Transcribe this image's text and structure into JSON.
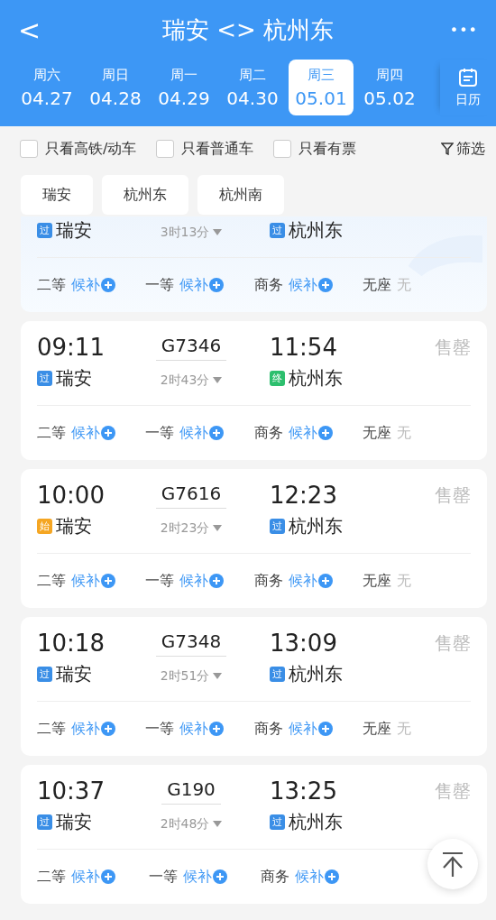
{
  "header": {
    "back": "<",
    "title": "瑞安 <> 杭州东",
    "more": "•••"
  },
  "dates": [
    {
      "weekday": "周六",
      "date": "04.27",
      "selected": false
    },
    {
      "weekday": "周日",
      "date": "04.28",
      "selected": false
    },
    {
      "weekday": "周一",
      "date": "04.29",
      "selected": false
    },
    {
      "weekday": "周二",
      "date": "04.30",
      "selected": false
    },
    {
      "weekday": "周三",
      "date": "05.01",
      "selected": true
    },
    {
      "weekday": "周四",
      "date": "05.02",
      "selected": false
    }
  ],
  "calendar": {
    "label": "日历"
  },
  "filters": [
    {
      "label": "只看高铁/动车",
      "checked": false
    },
    {
      "label": "只看普通车",
      "checked": false
    },
    {
      "label": "只看有票",
      "checked": false
    }
  ],
  "filter_button": "筛选",
  "stations": [
    "瑞安",
    "杭州东",
    "杭州南"
  ],
  "trains": [
    {
      "kind": "partial",
      "from": {
        "badge": "过",
        "color": "#3a8ee6",
        "name": "瑞安"
      },
      "duration": "3时13分",
      "to": {
        "badge": "过",
        "color": "#3a8ee6",
        "name": "杭州东"
      },
      "seats": [
        {
          "class": "二等",
          "status": "候补",
          "kind": "waitlist"
        },
        {
          "class": "一等",
          "status": "候补",
          "kind": "waitlist"
        },
        {
          "class": "商务",
          "status": "候补",
          "kind": "waitlist"
        },
        {
          "class": "无座",
          "status": "无",
          "kind": "none"
        }
      ]
    },
    {
      "kind": "full",
      "depart": "09:11",
      "number": "G7346",
      "arrive": "11:54",
      "status": "售罄",
      "from": {
        "badge": "过",
        "color": "#3a8ee6",
        "name": "瑞安"
      },
      "duration": "2时43分",
      "to": {
        "badge": "终",
        "color": "#2dbf6e",
        "name": "杭州东"
      },
      "seats": [
        {
          "class": "二等",
          "status": "候补",
          "kind": "waitlist"
        },
        {
          "class": "一等",
          "status": "候补",
          "kind": "waitlist"
        },
        {
          "class": "商务",
          "status": "候补",
          "kind": "waitlist"
        },
        {
          "class": "无座",
          "status": "无",
          "kind": "none"
        }
      ]
    },
    {
      "kind": "full",
      "depart": "10:00",
      "number": "G7616",
      "arrive": "12:23",
      "status": "售罄",
      "from": {
        "badge": "始",
        "color": "#f5a623",
        "name": "瑞安"
      },
      "duration": "2时23分",
      "to": {
        "badge": "过",
        "color": "#3a8ee6",
        "name": "杭州东"
      },
      "seats": [
        {
          "class": "二等",
          "status": "候补",
          "kind": "waitlist"
        },
        {
          "class": "一等",
          "status": "候补",
          "kind": "waitlist"
        },
        {
          "class": "商务",
          "status": "候补",
          "kind": "waitlist"
        },
        {
          "class": "无座",
          "status": "无",
          "kind": "none"
        }
      ]
    },
    {
      "kind": "full",
      "depart": "10:18",
      "number": "G7348",
      "arrive": "13:09",
      "status": "售罄",
      "from": {
        "badge": "过",
        "color": "#3a8ee6",
        "name": "瑞安"
      },
      "duration": "2时51分",
      "to": {
        "badge": "过",
        "color": "#3a8ee6",
        "name": "杭州东"
      },
      "seats": [
        {
          "class": "二等",
          "status": "候补",
          "kind": "waitlist"
        },
        {
          "class": "一等",
          "status": "候补",
          "kind": "waitlist"
        },
        {
          "class": "商务",
          "status": "候补",
          "kind": "waitlist"
        },
        {
          "class": "无座",
          "status": "无",
          "kind": "none"
        }
      ]
    },
    {
      "kind": "full",
      "depart": "10:37",
      "number": "G190",
      "arrive": "13:25",
      "status": "售罄",
      "from": {
        "badge": "过",
        "color": "#3a8ee6",
        "name": "瑞安"
      },
      "duration": "2时48分",
      "to": {
        "badge": "过",
        "color": "#3a8ee6",
        "name": "杭州东"
      },
      "seats": [
        {
          "class": "二等",
          "status": "候补",
          "kind": "waitlist"
        },
        {
          "class": "一等",
          "status": "候补",
          "kind": "waitlist"
        },
        {
          "class": "商务",
          "status": "候补",
          "kind": "waitlist"
        }
      ]
    }
  ]
}
